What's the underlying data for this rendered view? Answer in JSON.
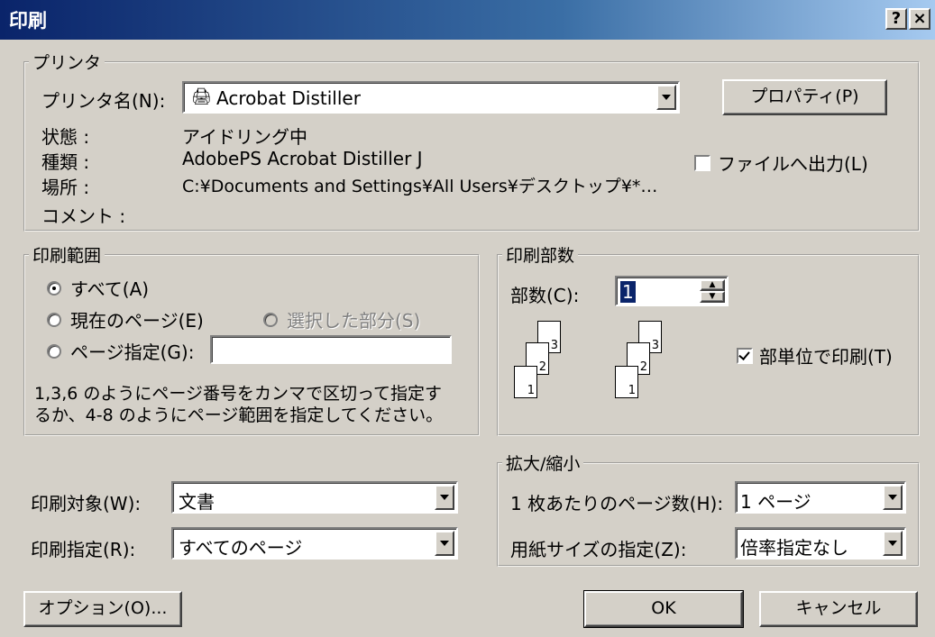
{
  "window": {
    "title": "印刷",
    "help_label": "?",
    "close_label": "×"
  },
  "printer_group": {
    "label": "プリンタ",
    "name_label": "プリンタ名(N):",
    "name_value": "Acrobat Distiller",
    "properties_button": "プロパティ(P)",
    "status_label": "状態 :",
    "status_value": "アイドリング中",
    "type_label": "種類 :",
    "type_value": "AdobePS Acrobat Distiller J",
    "location_label": "場所 :",
    "location_value": "C:¥Documents and Settings¥All Users¥デスクトップ¥*…",
    "comment_label": "コメント :",
    "print_to_file_label": "ファイルへ出力(L)",
    "print_to_file_checked": false
  },
  "range_group": {
    "label": "印刷範囲",
    "all_label": "すべて(A)",
    "current_label": "現在のページ(E)",
    "selection_label": "選択した部分(S)",
    "pages_label": "ページ指定(G):",
    "pages_value": "",
    "help_text_1": "1,3,6 のようにページ番号をカンマで区切って指定す",
    "help_text_2": "るか、4-8 のようにページ範囲を指定してください。",
    "selected": "all"
  },
  "copies_group": {
    "label": "印刷部数",
    "copies_label": "部数(C):",
    "copies_value": "1",
    "collate_label": "部単位で印刷(T)",
    "collate_checked": true,
    "page_numbers": [
      "1",
      "2",
      "3"
    ]
  },
  "print_what": {
    "label": "印刷対象(W):",
    "value": "文書"
  },
  "print_spec": {
    "label": "印刷指定(R):",
    "value": "すべてのページ"
  },
  "zoom_group": {
    "label": "拡大/縮小",
    "pages_per_sheet_label": "1 枚あたりのページ数(H):",
    "pages_per_sheet_value": "1 ページ",
    "scale_label": "用紙サイズの指定(Z):",
    "scale_value": "倍率指定なし"
  },
  "buttons": {
    "options": "オプション(O)...",
    "ok": "OK",
    "cancel": "キャンセル"
  }
}
